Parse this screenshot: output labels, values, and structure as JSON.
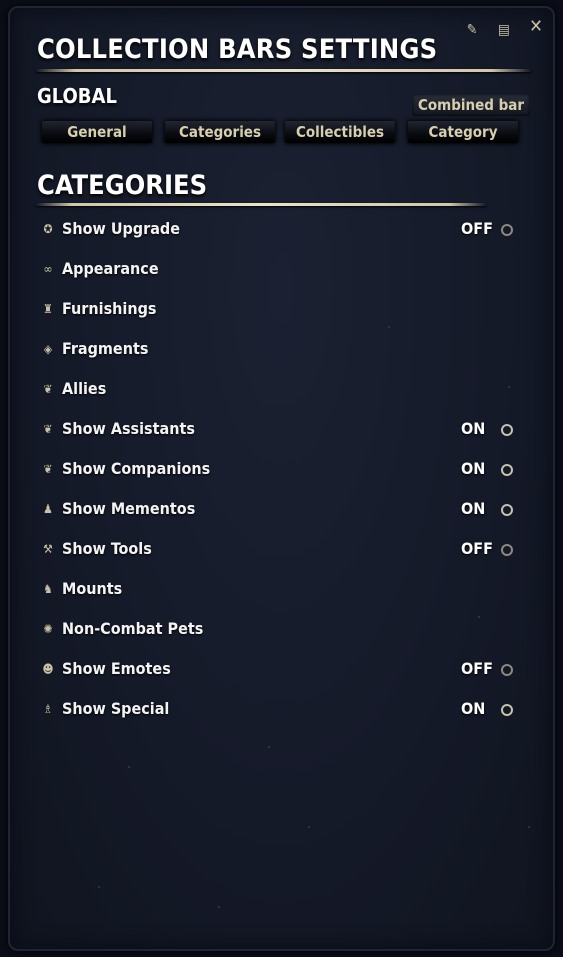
{
  "window": {
    "title": "COLLECTION BARS SETTINGS",
    "subtitle": "GLOBAL",
    "icons": [
      "edit-icon",
      "document-icon",
      "close-icon"
    ]
  },
  "toolbar": {
    "combined_bar_label": "Combined bar"
  },
  "tabs": [
    {
      "label": "General"
    },
    {
      "label": "Categories"
    },
    {
      "label": "Collectibles"
    },
    {
      "label": "Category"
    }
  ],
  "section": {
    "title": "CATEGORIES"
  },
  "categories": [
    {
      "icon": "upgrade-icon",
      "label": "Show Upgrade",
      "value": "OFF"
    },
    {
      "icon": "appearance-icon",
      "label": "Appearance",
      "value": null
    },
    {
      "icon": "furnishings-icon",
      "label": "Furnishings",
      "value": null
    },
    {
      "icon": "fragments-icon",
      "label": "Fragments",
      "value": null
    },
    {
      "icon": "allies-icon",
      "label": "Allies",
      "value": null
    },
    {
      "icon": "assistants-icon",
      "label": "Show Assistants",
      "value": "ON"
    },
    {
      "icon": "companions-icon",
      "label": "Show Companions",
      "value": "ON"
    },
    {
      "icon": "mementos-icon",
      "label": "Show Mementos",
      "value": "ON"
    },
    {
      "icon": "tools-icon",
      "label": "Show Tools",
      "value": "OFF"
    },
    {
      "icon": "mounts-icon",
      "label": "Mounts",
      "value": null
    },
    {
      "icon": "pets-icon",
      "label": "Non-Combat Pets",
      "value": null
    },
    {
      "icon": "emotes-icon",
      "label": "Show Emotes",
      "value": "OFF"
    },
    {
      "icon": "special-icon",
      "label": "Show Special",
      "value": "ON"
    }
  ]
}
